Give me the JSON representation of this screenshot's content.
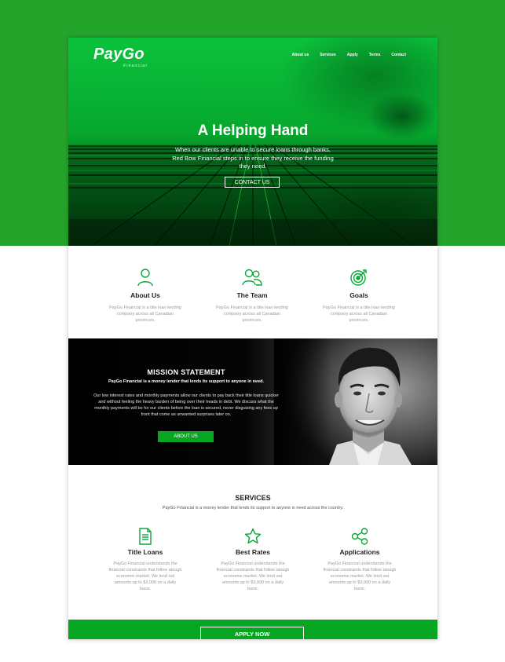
{
  "colors": {
    "brand_green": "#07a622",
    "backdrop_green": "#25a42c",
    "icon_green": "#0aa63a"
  },
  "brand": {
    "name": "PayGo",
    "tagline": "Financial"
  },
  "nav": {
    "items": [
      "About us",
      "Services",
      "Apply",
      "Terms",
      "Contact"
    ]
  },
  "hero": {
    "title": "A Helping Hand",
    "subtitle": "When our clients are unable to secure loans through banks, Red Bow Financial steps in to ensure they receive the funding they need.",
    "cta": "CONTACT US"
  },
  "features": [
    {
      "icon": "person-icon",
      "title": "About Us",
      "desc": "PayGo Financial is a title loan lending company across all Canadian provinces."
    },
    {
      "icon": "team-icon",
      "title": "The Team",
      "desc": "PayGo Financial is a title loan lending company across all Canadian provinces."
    },
    {
      "icon": "target-icon",
      "title": "Goals",
      "desc": "PayGo Financial is a title loan lending company across all Canadian provinces."
    }
  ],
  "mission": {
    "title": "MISSION STATEMENT",
    "subtitle": "PayGo Financial is a money lender that lends its support to anyone in need.",
    "body": "Our low interest rates and monthly payments allow our clients to pay back their title loans quicker and without feeling the heavy burden of being over their heads in debt. We discuss what the monthly payments will be for our clients before the loan is secured, never disguising any fees up front that come as unwanted surprises later on.",
    "cta": "ABOUT US"
  },
  "services": {
    "title": "SERVICES",
    "subtitle": "PayGo Financial is a money lender that lends its support to anyone in need across the country.",
    "items": [
      {
        "icon": "document-icon",
        "title": "Title Loans",
        "desc": "PayGo Financial understands the financial constraints that follow atough economic market. We lend out amounts up to $3,000 on a daily basis."
      },
      {
        "icon": "star-icon",
        "title": "Best Rates",
        "desc": "PayGo Financial understands the financial constraints that follow atough economic market. We lend out amounts up to $3,000 on a daily basis."
      },
      {
        "icon": "share-icon",
        "title": "Applications",
        "desc": "PayGo Financial understands the financial constraints that follow atough economic market. We lend out amounts up to $3,000 on a daily basis."
      }
    ]
  },
  "footer": {
    "cta": "APPLY NOW"
  }
}
